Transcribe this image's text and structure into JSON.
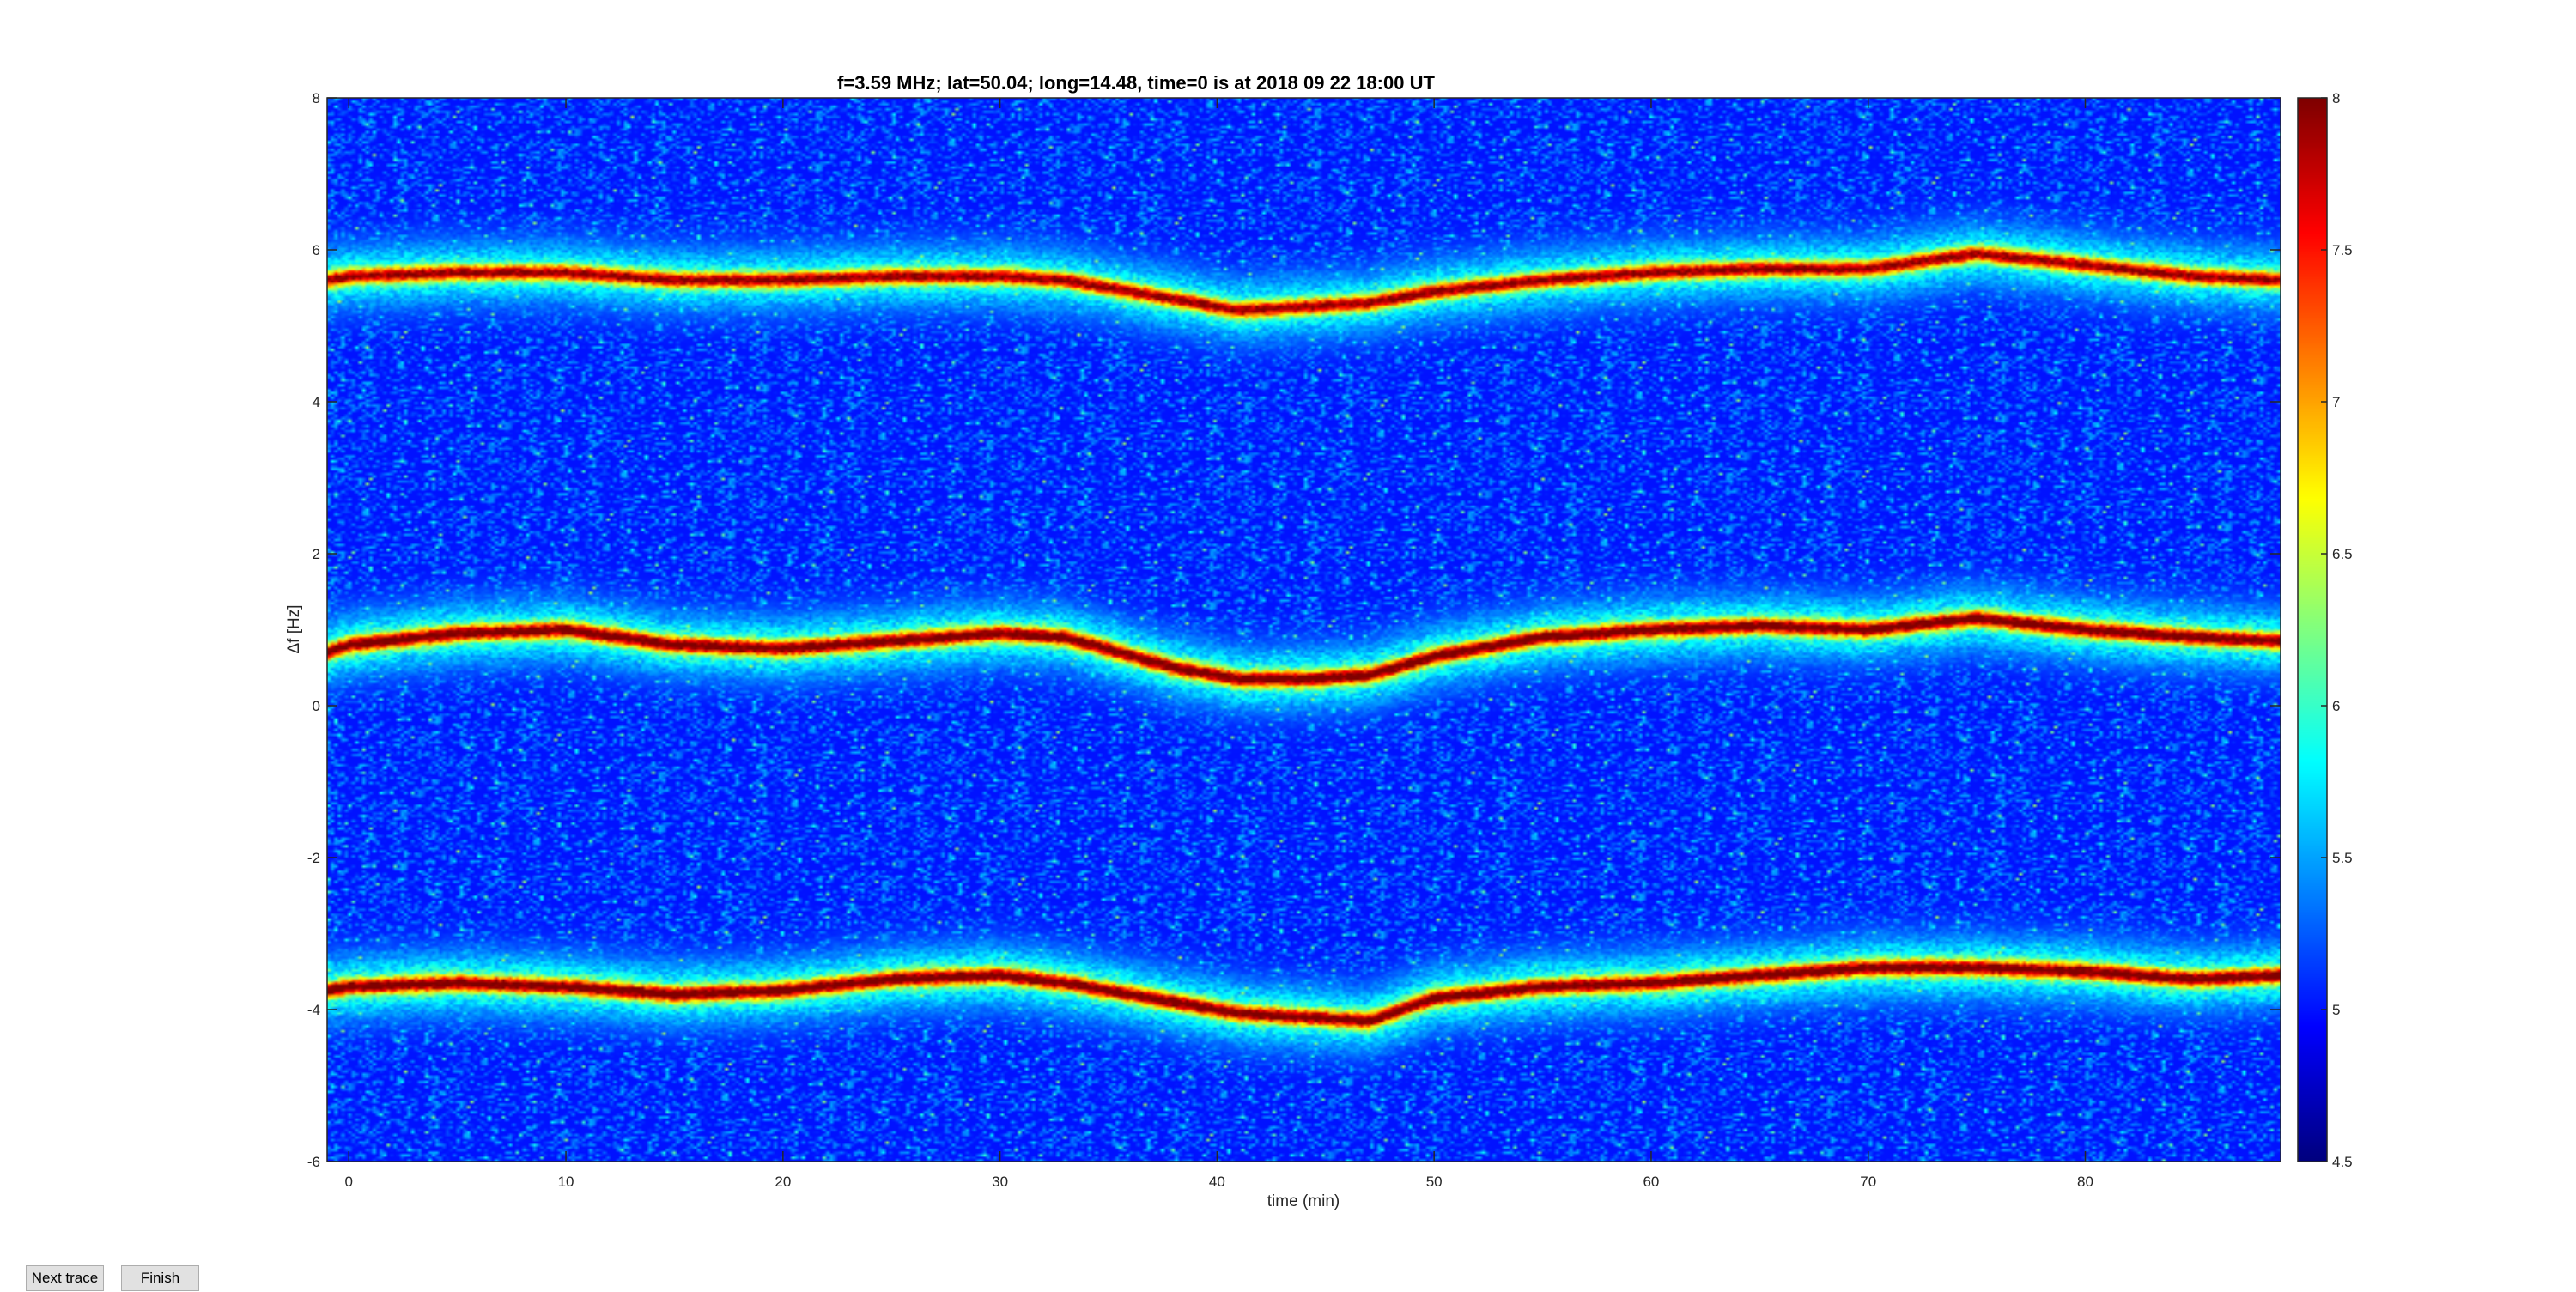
{
  "chart_data": {
    "type": "heatmap",
    "title": "f=3.59 MHz;  lat=50.04; long=14.48, time=0 is at 2018 09 22 18:00 UT",
    "xlabel": "time (min)",
    "ylabel": "Δf [Hz]",
    "xlim": [
      -1,
      89
    ],
    "ylim": [
      -6,
      8
    ],
    "xticks": [
      "0",
      "10",
      "20",
      "30",
      "40",
      "50",
      "60",
      "70",
      "80"
    ],
    "yticks": [
      "-6",
      "-4",
      "-2",
      "0",
      "2",
      "4",
      "6",
      "8"
    ],
    "colorbar": {
      "colormap": "jet",
      "clim": [
        4.5,
        8
      ],
      "ticks": [
        "4.5",
        "5",
        "5.5",
        "6",
        "6.5",
        "7",
        "7.5",
        "8"
      ]
    },
    "background_level": 5.0,
    "grid": false,
    "traces": [
      {
        "time_min": [
          -1,
          0,
          5,
          10,
          15,
          20,
          25,
          30,
          33,
          38,
          41,
          44,
          47,
          50,
          55,
          60,
          65,
          70,
          75,
          80,
          85,
          89
        ],
        "df_hz": [
          5.6,
          5.65,
          5.7,
          5.7,
          5.6,
          5.6,
          5.65,
          5.65,
          5.6,
          5.35,
          5.2,
          5.25,
          5.3,
          5.45,
          5.6,
          5.7,
          5.75,
          5.75,
          5.95,
          5.8,
          5.65,
          5.6
        ],
        "peak_level": 7.6
      },
      {
        "time_min": [
          -1,
          0,
          5,
          10,
          15,
          20,
          25,
          30,
          33,
          38,
          41,
          44,
          47,
          50,
          55,
          60,
          65,
          70,
          75,
          80,
          85,
          89
        ],
        "df_hz": [
          0.7,
          0.8,
          0.95,
          1.0,
          0.8,
          0.75,
          0.85,
          0.95,
          0.9,
          0.5,
          0.35,
          0.35,
          0.4,
          0.65,
          0.9,
          1.0,
          1.05,
          1.0,
          1.15,
          1.0,
          0.9,
          0.85
        ],
        "peak_level": 7.8
      },
      {
        "time_min": [
          -1,
          0,
          5,
          10,
          15,
          20,
          25,
          30,
          33,
          38,
          41,
          44,
          47,
          50,
          55,
          60,
          65,
          70,
          75,
          80,
          85,
          89
        ],
        "df_hz": [
          -3.75,
          -3.7,
          -3.65,
          -3.7,
          -3.8,
          -3.75,
          -3.6,
          -3.55,
          -3.65,
          -3.9,
          -4.05,
          -4.1,
          -4.15,
          -3.85,
          -3.7,
          -3.65,
          -3.55,
          -3.45,
          -3.45,
          -3.5,
          -3.6,
          -3.55
        ],
        "peak_level": 7.8
      }
    ]
  },
  "buttons": {
    "next_trace": "Next trace",
    "finish": "Finish"
  }
}
